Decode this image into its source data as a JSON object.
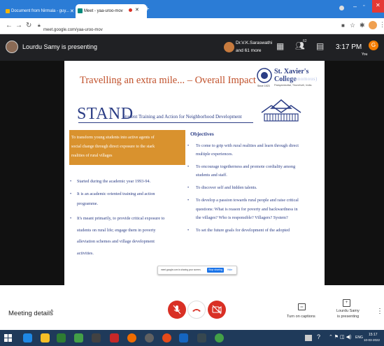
{
  "browser": {
    "tabs": [
      {
        "label": "Document from Nirmala - guy..."
      },
      {
        "label": "Meet - yaa-uroo-mov"
      }
    ],
    "url": "meet.google.com/yaa-uroo-mov"
  },
  "meet": {
    "presenter_label": "Lourdu Samy is presenting",
    "participants_label_line1": "Dr.V.K.Saraswathi",
    "participants_label_line2": "and 61 more",
    "participant_count_badge": "62",
    "time": "3:17 PM",
    "self_label": "You",
    "self_initial": "G"
  },
  "slide": {
    "title": "Travelling an extra mile... – Overall Impact",
    "college_name": "St. Xavier's College",
    "college_sub": "(Autonomous)",
    "college_place": "Palayamkottai, Tirunelveli, India.",
    "logo_caption": "Since 1923",
    "stand": "STAND",
    "stand_expansion": "Student Training and Action for Neighborhood  Development",
    "highlight_lines": [
      "To transform young students into active agents of",
      "social change through direct exposure to the stark",
      "realities of rural villages"
    ],
    "left_bullets": [
      [
        "Started during the academic  year 1993-94."
      ],
      [
        "It  is  an  academic  oriented  training  and  action",
        "programme."
      ],
      [
        "It's meant primarily, to provide critical exposure to",
        "students  on  rural  life;  engage  them  in  poverty",
        "alleviation   schemes   and   village   development",
        "activities."
      ]
    ],
    "objectives_heading": "Objectives",
    "objectives": [
      [
        "To come to grip with rural realities and learn through direct",
        "multiple experiences."
      ],
      [
        "To encourage togetherness and promote cordiality among",
        "students and staff."
      ],
      [
        "To discover self and hidden talents."
      ],
      [
        "To develop a passion towards rural people and raise critical",
        "questions: What is reason for poverty and backwardness in",
        "the villages? Who is responsible? Villagers? System?"
      ],
      [
        "To set the future goals for development of the adopted"
      ]
    ],
    "share_notice": "meet.google.com is sharing your screen.",
    "stop_sharing": "Stop sharing",
    "hide": "Hide"
  },
  "bottom": {
    "meeting_details": "Meeting details",
    "captions_label": "Turn on captions",
    "presenting_line1": "Lourdu Samy",
    "presenting_line2": "is presenting"
  },
  "taskbar": {
    "lang": "ENG",
    "time": "15:17",
    "date": "10-03-2022"
  },
  "colors": {
    "chrome_blue": "#2b7cd6",
    "meet_dark": "#202124",
    "slide_title": "#c0502a",
    "slide_text": "#2b3d85",
    "highlight_box": "#d9922e",
    "hangup_red": "#d93025",
    "taskbar": "#1f3a5a"
  }
}
